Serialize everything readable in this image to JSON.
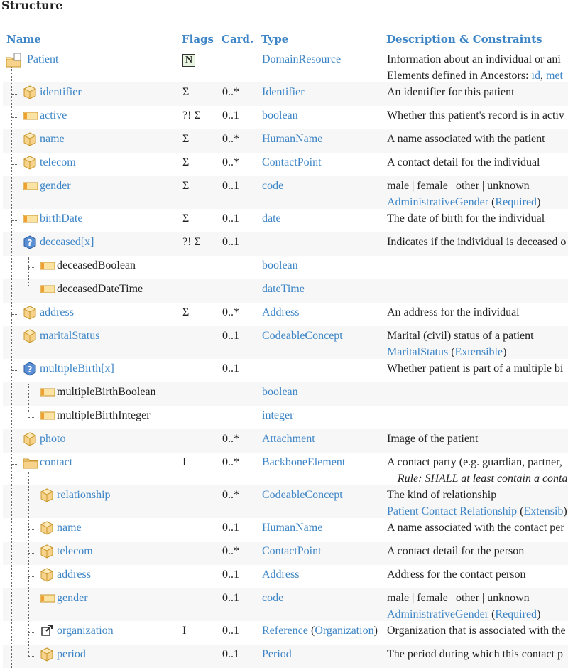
{
  "heading": "Structure",
  "columns": {
    "name": "Name",
    "flags": "Flags",
    "card": "Card.",
    "type": "Type",
    "desc": "Description & Constraints"
  },
  "rows": [
    {
      "name": "Patient",
      "flags": "N",
      "card": "",
      "type": "DomainResource",
      "desc": "Information about an individual or ani",
      "desc2_prefix": "Elements defined in Ancestors: ",
      "desc2_links": [
        "id",
        ", ",
        "met"
      ]
    },
    {
      "name": "identifier",
      "flags": "Σ",
      "card": "0..*",
      "type": "Identifier",
      "desc": "An identifier for this patient"
    },
    {
      "name": "active",
      "flags": "?! Σ",
      "card": "0..1",
      "type": "boolean",
      "desc": "Whether this patient's record is in activ"
    },
    {
      "name": "name",
      "flags": "Σ",
      "card": "0..*",
      "type": "HumanName",
      "desc": "A name associated with the patient"
    },
    {
      "name": "telecom",
      "flags": "Σ",
      "card": "0..*",
      "type": "ContactPoint",
      "desc": "A contact detail for the individual"
    },
    {
      "name": "gender",
      "flags": "Σ",
      "card": "0..1",
      "type": "code",
      "desc": "male | female | other | unknown",
      "desc2_link": "AdministrativeGender",
      "desc2_paren": "Required"
    },
    {
      "name": "birthDate",
      "flags": "Σ",
      "card": "0..1",
      "type": "date",
      "desc": "The date of birth for the individual"
    },
    {
      "name": "deceased[x]",
      "flags": "?! Σ",
      "card": "0..1",
      "type": "",
      "desc": "Indicates if the individual is deceased o"
    },
    {
      "name": "deceasedBoolean",
      "flags": "",
      "card": "",
      "type": "boolean",
      "desc": ""
    },
    {
      "name": "deceasedDateTime",
      "flags": "",
      "card": "",
      "type": "dateTime",
      "desc": ""
    },
    {
      "name": "address",
      "flags": "Σ",
      "card": "0..*",
      "type": "Address",
      "desc": "An address for the individual"
    },
    {
      "name": "maritalStatus",
      "flags": "",
      "card": "0..1",
      "type": "CodeableConcept",
      "desc": "Marital (civil) status of a patient",
      "desc2_link": "MaritalStatus",
      "desc2_paren": "Extensible"
    },
    {
      "name": "multipleBirth[x]",
      "flags": "",
      "card": "0..1",
      "type": "",
      "desc": "Whether patient is part of a multiple bi"
    },
    {
      "name": "multipleBirthBoolean",
      "flags": "",
      "card": "",
      "type": "boolean",
      "desc": ""
    },
    {
      "name": "multipleBirthInteger",
      "flags": "",
      "card": "",
      "type": "integer",
      "desc": ""
    },
    {
      "name": "photo",
      "flags": "",
      "card": "0..*",
      "type": "Attachment",
      "desc": "Image of the patient"
    },
    {
      "name": "contact",
      "flags": "I",
      "card": "0..*",
      "type": "BackboneElement",
      "desc": "A contact party (e.g. guardian, partner,",
      "desc2_italic": "+ Rule: SHALL at least contain a conta"
    },
    {
      "name": "relationship",
      "flags": "",
      "card": "0..*",
      "type": "CodeableConcept",
      "desc": "The kind of relationship",
      "desc2_link": "Patient Contact Relationship",
      "desc2_paren": "Extensib"
    },
    {
      "name": "name",
      "flags": "",
      "card": "0..1",
      "type": "HumanName",
      "desc": "A name associated with the contact per"
    },
    {
      "name": "telecom",
      "flags": "",
      "card": "0..*",
      "type": "ContactPoint",
      "desc": "A contact detail for the person"
    },
    {
      "name": "address",
      "flags": "",
      "card": "0..1",
      "type": "Address",
      "desc": "Address for the contact person"
    },
    {
      "name": "gender",
      "flags": "",
      "card": "0..1",
      "type": "code",
      "desc": "male | female | other | unknown",
      "desc2_link": "AdministrativeGender",
      "desc2_paren": "Required"
    },
    {
      "name": "organization",
      "flags": "I",
      "card": "0..1",
      "type": "Reference",
      "type_paren": "Organization",
      "desc": "Organization that is associated with the"
    },
    {
      "name": "period",
      "flags": "",
      "card": "0..1",
      "type": "Period",
      "desc": "The period during which this contact p"
    }
  ],
  "icons": [
    "folder-resource-icon",
    "cube-icon",
    "primitive-icon",
    "choice-icon",
    "folder-icon",
    "reference-icon"
  ]
}
